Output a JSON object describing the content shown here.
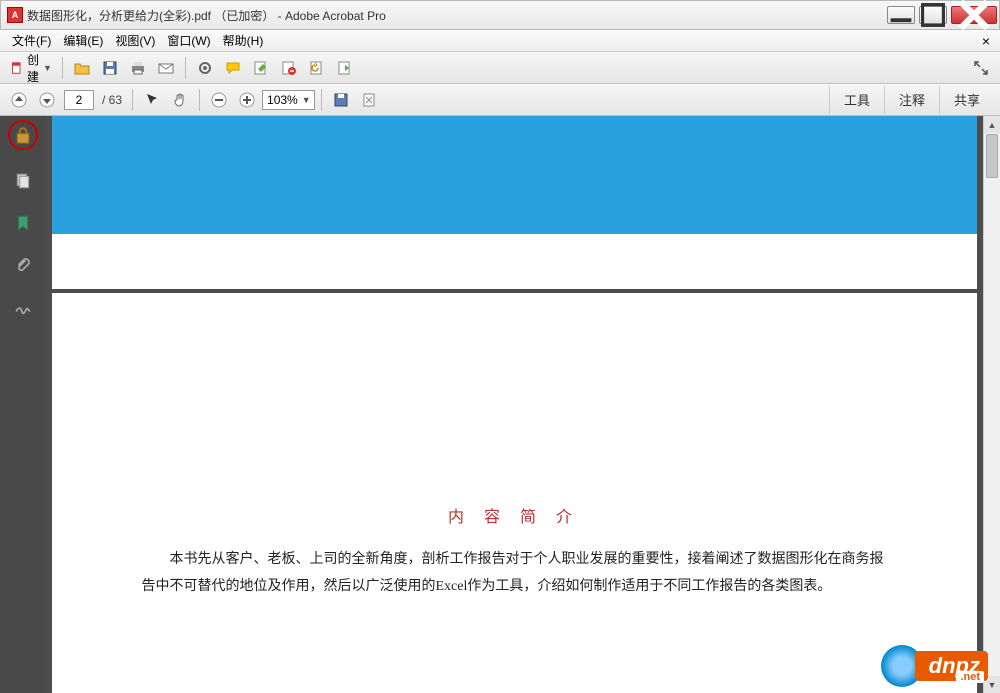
{
  "window": {
    "title": "数据图形化，分析更给力(全彩).pdf （已加密） - Adobe Acrobat Pro"
  },
  "menus": {
    "file": "文件(F)",
    "edit": "编辑(E)",
    "view": "视图(V)",
    "window": "窗口(W)",
    "help": "帮助(H)"
  },
  "toolbar": {
    "create_label": "创建"
  },
  "nav": {
    "current_page": "2",
    "total_pages": "/ 63",
    "zoom": "103%"
  },
  "right_tools": {
    "tools": "工具",
    "comment": "注释",
    "share": "共享"
  },
  "document": {
    "heading": "内 容 简 介",
    "paragraph": "本书先从客户、老板、上司的全新角度，剖析工作报告对于个人职业发展的重要性，接着阐述了数据图形化在商务报告中不可替代的地位及作用，然后以广泛使用的Excel作为工具，介绍如何制作适用于不同工作报告的各类图表。"
  },
  "watermark": {
    "text": "dnpz",
    "sub": ".net"
  }
}
